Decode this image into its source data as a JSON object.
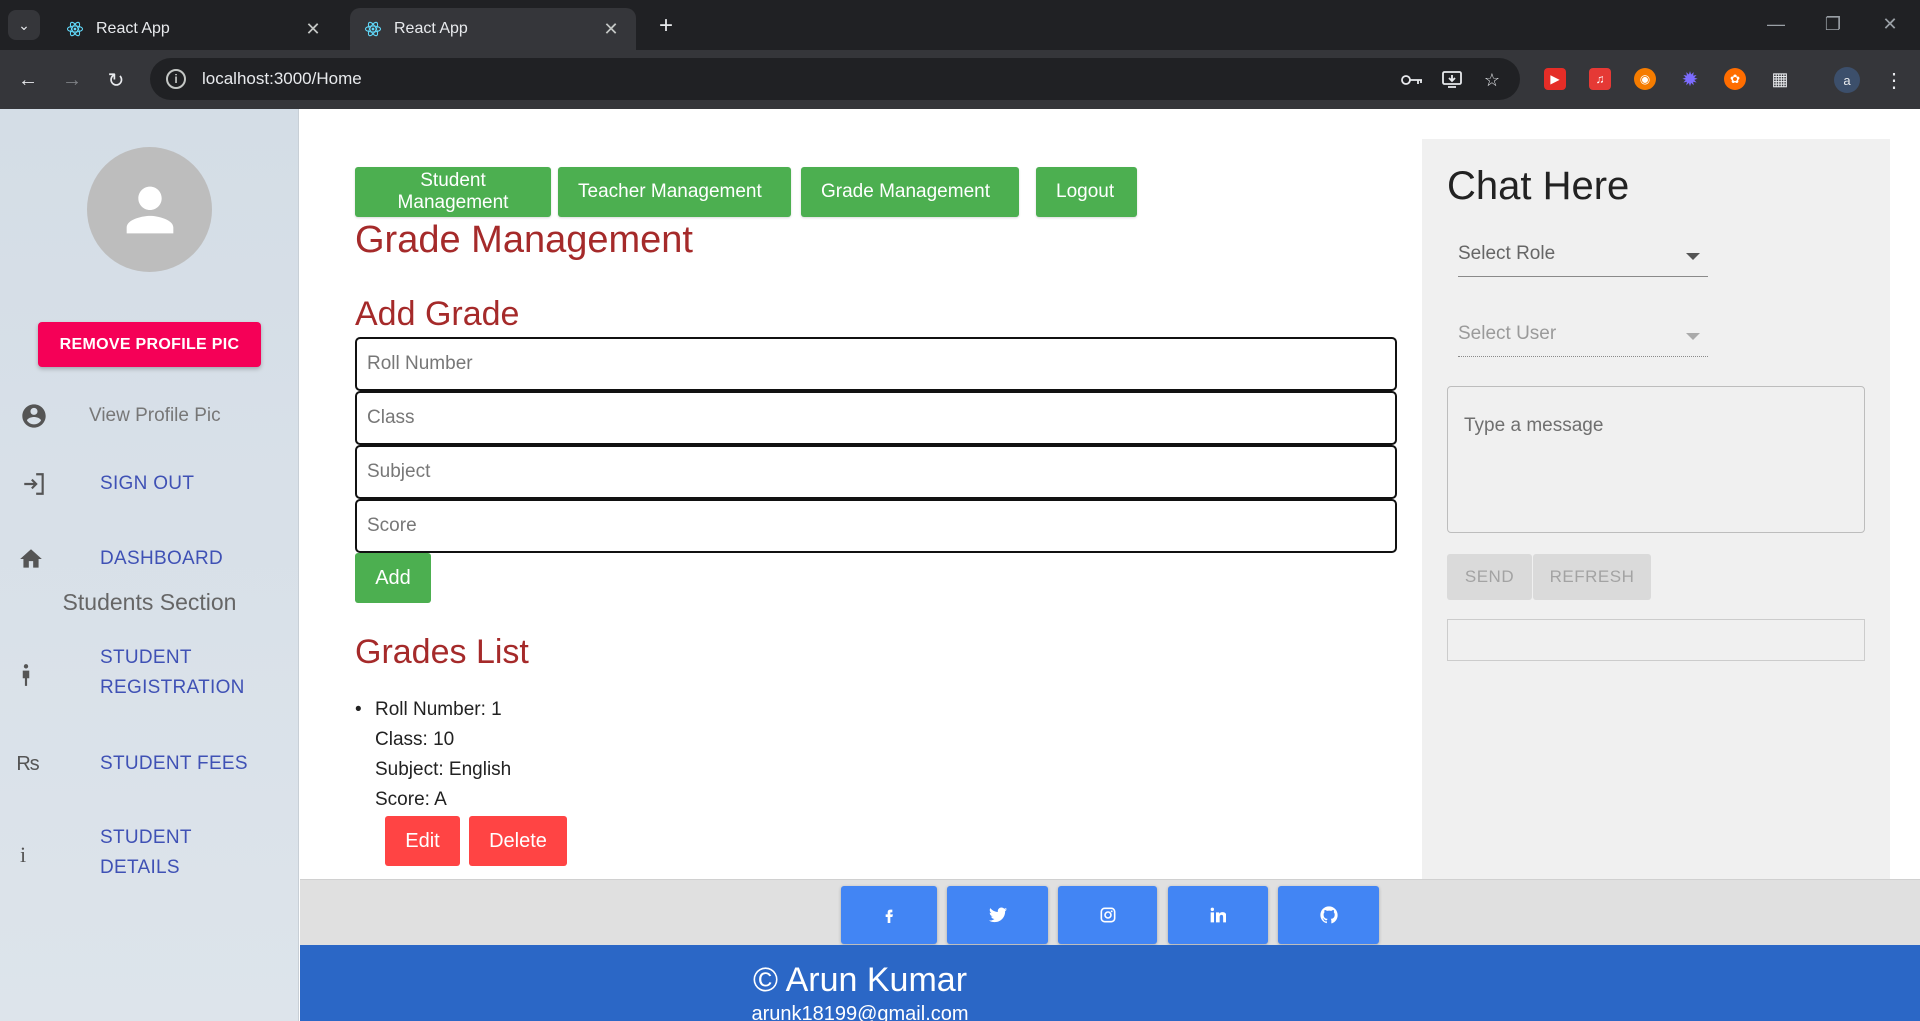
{
  "browser": {
    "tabs": [
      {
        "title": "React App",
        "active": false
      },
      {
        "title": "React App",
        "active": true
      }
    ],
    "url": "localhost:3000/Home",
    "profile_initial": "a"
  },
  "sidebar": {
    "remove_pic_label": "REMOVE PROFILE PIC",
    "view_pic_label": "View Profile Pic",
    "sign_out_label": "SIGN OUT",
    "dashboard_label": "DASHBOARD",
    "section_title": "Students Section",
    "student_registration_line1": "STUDENT",
    "student_registration_line2": "REGISTRATION",
    "student_fees_label": "STUDENT FEES",
    "student_details_line1": "STUDENT",
    "student_details_line2": "DETAILS"
  },
  "nav": {
    "student_management": "Student Management",
    "teacher_management": "Teacher Management",
    "grade_management": "Grade Management",
    "logout": "Logout"
  },
  "grades": {
    "page_title": "Grade Management",
    "add_title": "Add Grade",
    "roll_placeholder": "Roll Number",
    "class_placeholder": "Class",
    "subject_placeholder": "Subject",
    "score_placeholder": "Score",
    "add_label": "Add",
    "list_title": "Grades List",
    "items": [
      {
        "roll": "Roll Number: 1",
        "class": "Class: 10",
        "subject": "Subject: English",
        "score": "Score: A",
        "edit_label": "Edit",
        "delete_label": "Delete"
      }
    ]
  },
  "chat": {
    "title": "Chat Here",
    "role_placeholder": "Select Role",
    "user_placeholder": "Select User",
    "message_placeholder": "Type a message",
    "send_label": "SEND",
    "refresh_label": "REFRESH"
  },
  "footer": {
    "copyright": "© Arun Kumar",
    "email": "arunk18199@gmail.com",
    "social_icons": [
      "facebook-icon",
      "twitter-icon",
      "instagram-icon",
      "linkedin-icon",
      "github-icon"
    ]
  },
  "colors": {
    "green": "#4caf50",
    "red_button": "#ff4444",
    "pink_button": "#f50057",
    "heading": "#a52a2a",
    "social_blue": "#4285f4",
    "footer_blue": "#2b67c6"
  }
}
